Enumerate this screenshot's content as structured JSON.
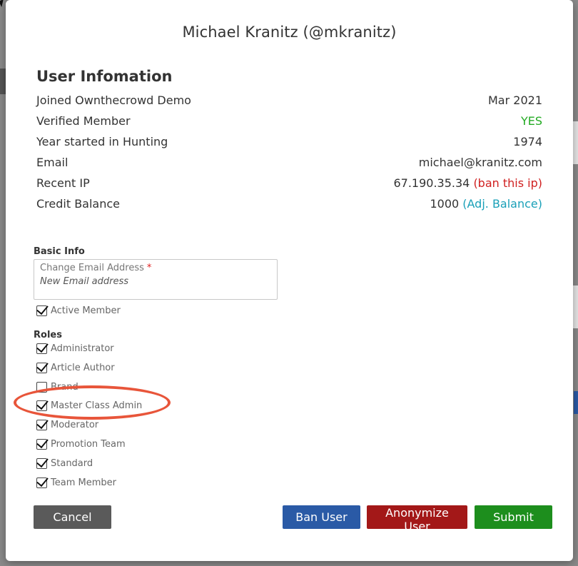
{
  "modal": {
    "title": "Michael Kranitz (@mkranitz)"
  },
  "user_info": {
    "heading": "User Infomation",
    "rows": [
      {
        "label": "Joined Ownthecrowd Demo",
        "value": "Mar 2021"
      },
      {
        "label": "Verified Member",
        "value": "YES"
      },
      {
        "label": "Year started in Hunting",
        "value": "1974"
      },
      {
        "label": "Email",
        "value": "michael@kranitz.com"
      },
      {
        "label": "Recent IP",
        "value": "67.190.35.34",
        "action": "(ban this ip)"
      },
      {
        "label": "Credit Balance",
        "value": "1000",
        "action": "(Adj. Balance)"
      }
    ]
  },
  "basic_info": {
    "heading": "Basic Info",
    "email_field": {
      "label": "Change Email Address",
      "required_mark": "*",
      "placeholder": "New Email address"
    },
    "active_member": {
      "label": "Active Member",
      "checked": true
    }
  },
  "roles": {
    "heading": "Roles",
    "items": [
      {
        "label": "Administrator",
        "checked": true
      },
      {
        "label": "Article Author",
        "checked": true
      },
      {
        "label": "Brand",
        "checked": false
      },
      {
        "label": "Master Class Admin",
        "checked": true
      },
      {
        "label": "Moderator",
        "checked": true
      },
      {
        "label": "Promotion Team",
        "checked": true
      },
      {
        "label": "Standard",
        "checked": true
      },
      {
        "label": "Team Member",
        "checked": true
      }
    ]
  },
  "buttons": {
    "cancel": "Cancel",
    "ban_user": "Ban User",
    "anonymize_user": "Anonymize User",
    "submit": "Submit"
  },
  "colors": {
    "verified_green": "#22aa22",
    "ban_red": "#d02020",
    "balance_teal": "#1aa0b8",
    "highlight": "#e8553a"
  }
}
